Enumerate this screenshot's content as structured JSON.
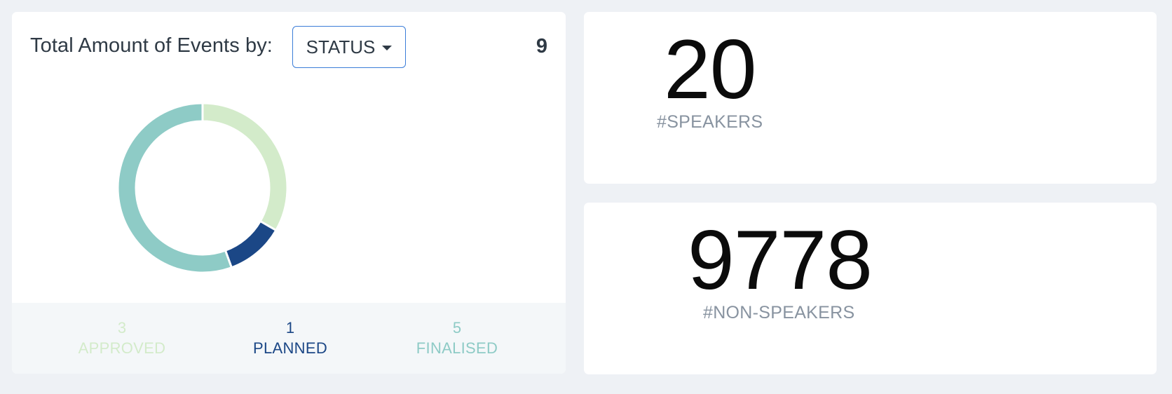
{
  "events_card": {
    "title": "Total Amount of Events by:",
    "dropdown_value": "STATUS",
    "total": "9",
    "chart_data": {
      "type": "pie",
      "categories": [
        "APPROVED",
        "PLANNED",
        "FINALISED"
      ],
      "values": [
        3,
        1,
        5
      ],
      "colors": [
        "#d3ebca",
        "#1b4786",
        "#8ecbc6"
      ]
    },
    "legend": [
      {
        "value": "3",
        "label": "APPROVED",
        "color": "#d3ebca"
      },
      {
        "value": "1",
        "label": "PLANNED",
        "color": "#1b4786"
      },
      {
        "value": "5",
        "label": "FINALISED",
        "color": "#8ecbc6"
      }
    ]
  },
  "speakers_card": {
    "value": "20",
    "label": "#SPEAKERS"
  },
  "nonspeakers_card": {
    "value": "9778",
    "label": "#NON-SPEAKERS"
  }
}
